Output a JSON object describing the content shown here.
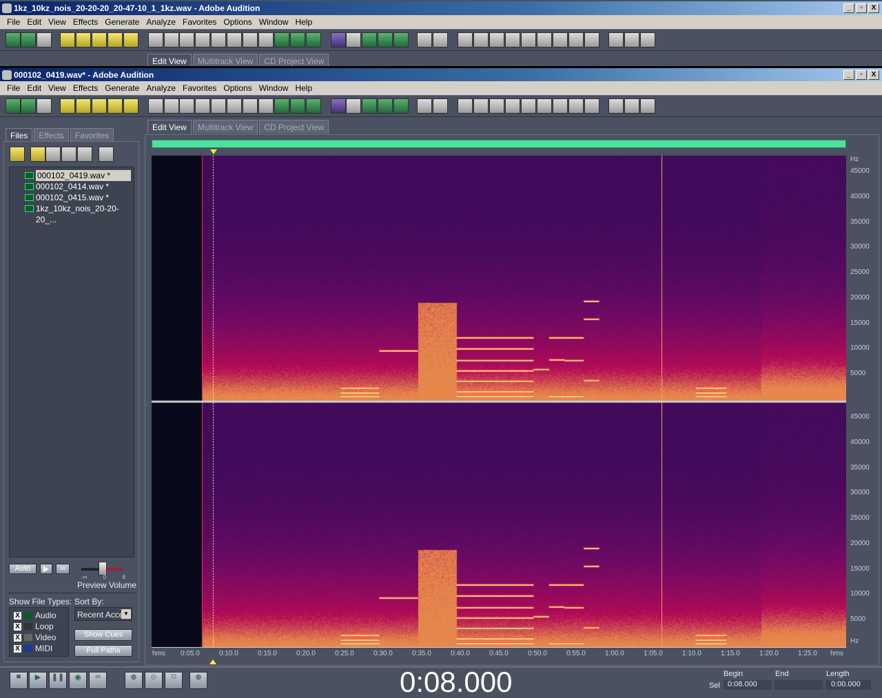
{
  "window1": {
    "title": "1kz_10kz_nois_20-20-20_20-47-10_1_1kz.wav - Adobe Audition"
  },
  "window2": {
    "title": "000102_0419.wav* - Adobe Audition"
  },
  "menu": [
    "File",
    "Edit",
    "View",
    "Effects",
    "Generate",
    "Analyze",
    "Favorites",
    "Options",
    "Window",
    "Help"
  ],
  "window_buttons": [
    "_",
    "▫",
    "X"
  ],
  "view_tabs": [
    "Edit View",
    "Multitrack View",
    "CD Project View"
  ],
  "left_tabs": [
    "Files",
    "Effects",
    "Favorites"
  ],
  "files": [
    "000102_0419.wav *",
    "000102_0414.wav *",
    "000102_0415.wav *",
    "1kz_10kz_nois_20-20-20_..."
  ],
  "preview": {
    "auto": "Auto",
    "label": "Preview Volume",
    "scale": [
      "-∞",
      "0",
      "6"
    ],
    "volume_db": 0
  },
  "show_file_types": {
    "label": "Show File Types:",
    "types": [
      {
        "name": "Audio",
        "checked": true
      },
      {
        "name": "Loop",
        "checked": true
      },
      {
        "name": "Video",
        "checked": true
      },
      {
        "name": "MIDI",
        "checked": true
      }
    ]
  },
  "sort_by": {
    "label": "Sort By:",
    "value": "Recent Acce"
  },
  "buttons": {
    "show_cues": "Show Cues",
    "full_paths": "Full Paths"
  },
  "freq_axis": {
    "unit": "Hz",
    "ticks": [
      "45000",
      "40000",
      "35000",
      "30000",
      "25000",
      "20000",
      "15000",
      "10000",
      "5000"
    ]
  },
  "time_axis": {
    "unit": "hms",
    "ticks": [
      "0:05.0",
      "0:10.0",
      "0:15.0",
      "0:20.0",
      "0:25.0",
      "0:30.0",
      "0:35.0",
      "0:40.0",
      "0:45.0",
      "0:50.0",
      "0:55.0",
      "1:00.0",
      "1:05.0",
      "1:10.0",
      "1:15.0",
      "1:20.0",
      "1:25.0"
    ]
  },
  "time_display": "0:08.000",
  "selection": {
    "headers": [
      "Begin",
      "End",
      "Length"
    ],
    "row_label": "Sel",
    "begin": "0:08.000",
    "end": "",
    "length": "0:00.000"
  }
}
